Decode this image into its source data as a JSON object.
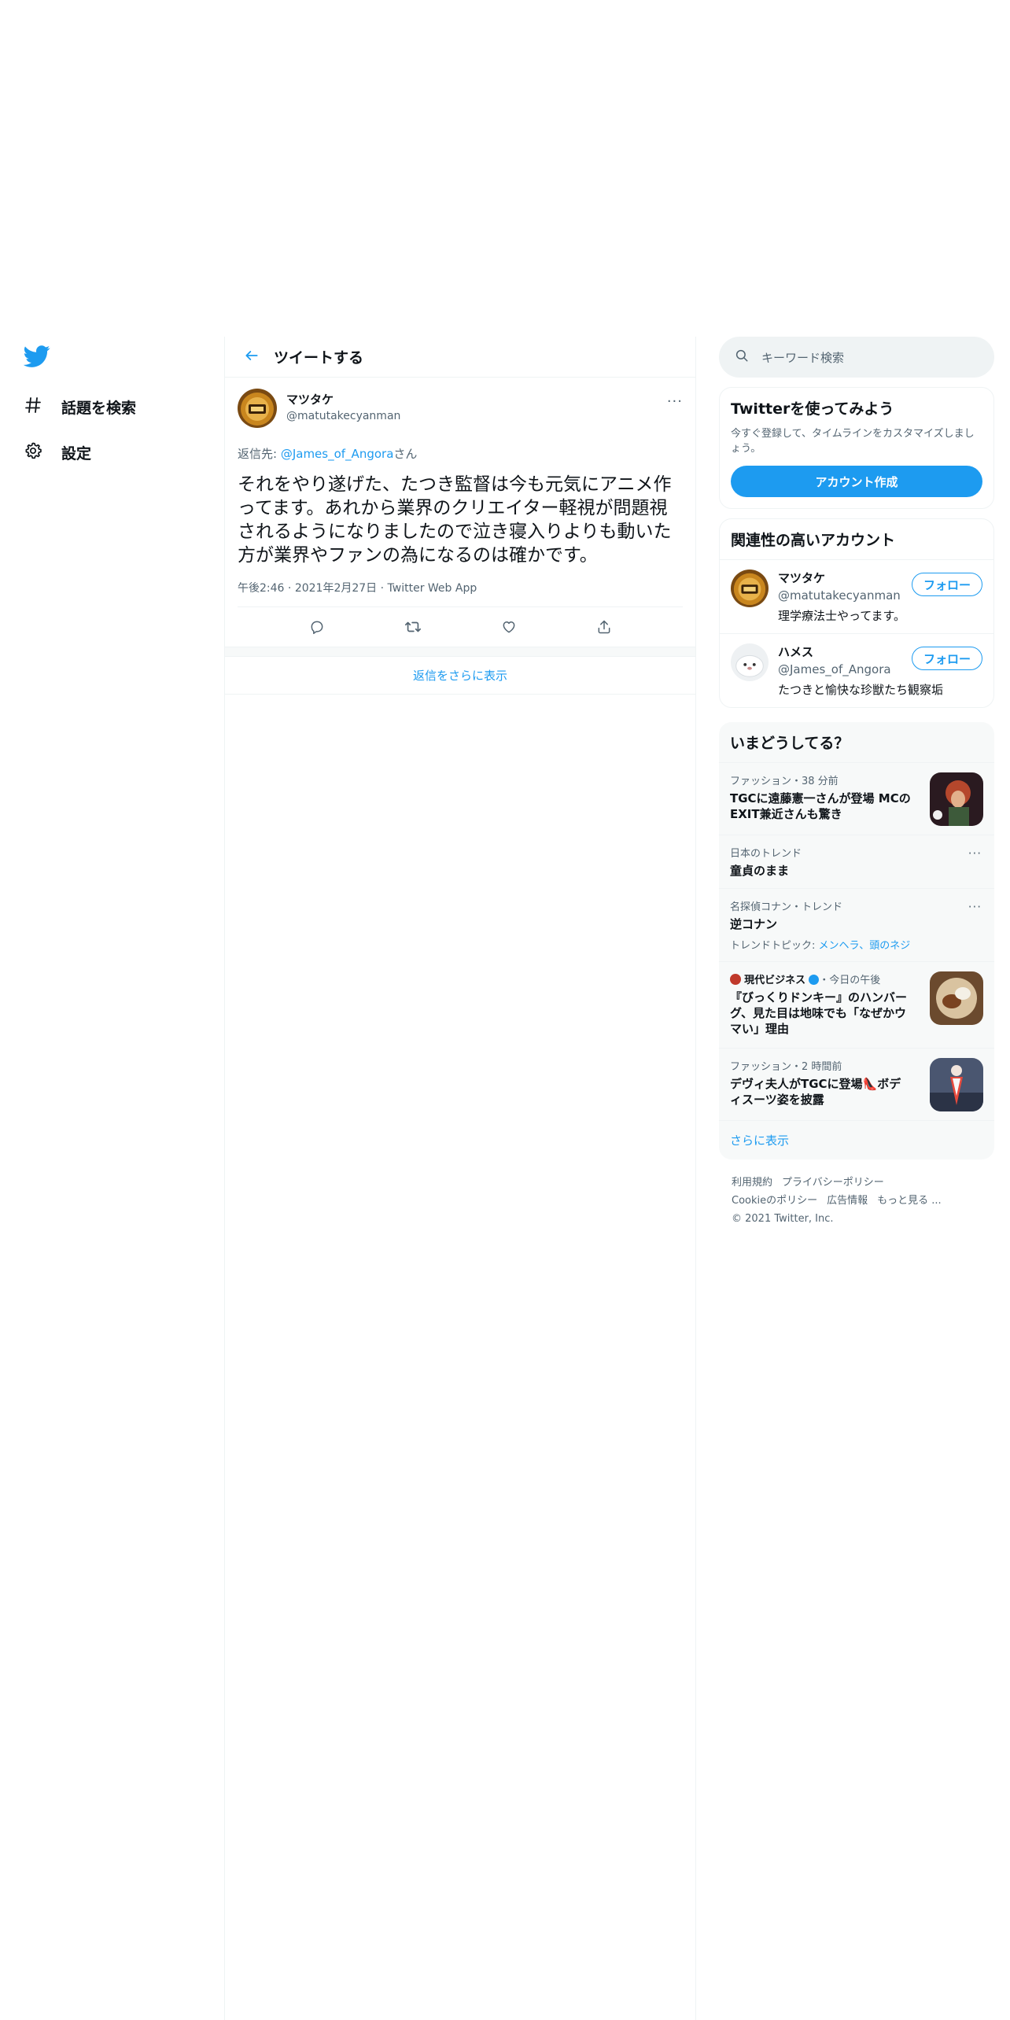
{
  "nav": {
    "items": [
      {
        "label": "話題を検索",
        "icon": "hashtag-icon"
      },
      {
        "label": "設定",
        "icon": "gear-icon"
      }
    ]
  },
  "main": {
    "header_title": "ツイートする",
    "tweet": {
      "author_name": "マツタケ",
      "author_handle": "@matutakecyanman",
      "reply_prefix": "返信先: ",
      "reply_handle": "@James_of_Angora",
      "reply_suffix": "さん",
      "text": "それをやり遂げた、たつき監督は今も元気にアニメ作ってます。あれから業界のクリエイター軽視が問題視されるようになりましたので泣き寝入りよりも動いた方が業界やファンの為になるのは確かです。",
      "time": "午後2:46",
      "date": "2021年2月27日",
      "source": "Twitter Web App"
    },
    "show_more_replies": "返信をさらに表示"
  },
  "right": {
    "search_placeholder": "キーワード検索",
    "signup": {
      "title": "Twitterを使ってみよう",
      "desc": "今すぐ登録して、タイムラインをカスタマイズしましょう。",
      "button": "アカウント作成"
    },
    "related": {
      "title": "関連性の高いアカウント",
      "accounts": [
        {
          "name": "マツタケ",
          "handle": "@matutakecyanman",
          "bio": "理学療法士やってます。",
          "follow": "フォロー"
        },
        {
          "name": "ハメス",
          "handle": "@James_of_Angora",
          "bio": "たつきと愉快な珍獣たち観察垢",
          "follow": "フォロー"
        }
      ]
    },
    "trends": {
      "title": "いまどうしてる？",
      "items": [
        {
          "category": "ファッション・38 分前",
          "title": "TGCに遠藤憲一さんが登場 MCのEXIT兼近さんも驚き"
        },
        {
          "category": "日本のトレンド",
          "title": "童貞のまま"
        },
        {
          "category": "名探偵コナン・トレンド",
          "title": "逆コナン",
          "topics_label": "トレンドトピック: ",
          "topics": "メンヘラ、頭のネジ"
        },
        {
          "category_source": "現代ビジネス",
          "category_time": "・今日の午後",
          "title": "『びっくりドンキー』のハンバーグ、見た目は地味でも「なぜかウマい」理由"
        },
        {
          "category": "ファッション・2 時間前",
          "title": "デヴィ夫人がTGCに登場👠ボディスーツ姿を披露"
        }
      ],
      "show_more": "さらに表示"
    },
    "footer": {
      "links1": [
        "利用規約",
        "プライバシーポリシー"
      ],
      "links2": [
        "Cookieのポリシー",
        "広告情報",
        "もっと見る ..."
      ],
      "copyright": "© 2021 Twitter, Inc."
    }
  },
  "colors": {
    "accent": "#1d9bf0",
    "text": "#0f1419",
    "muted": "#536471",
    "border": "#eff3f4"
  }
}
